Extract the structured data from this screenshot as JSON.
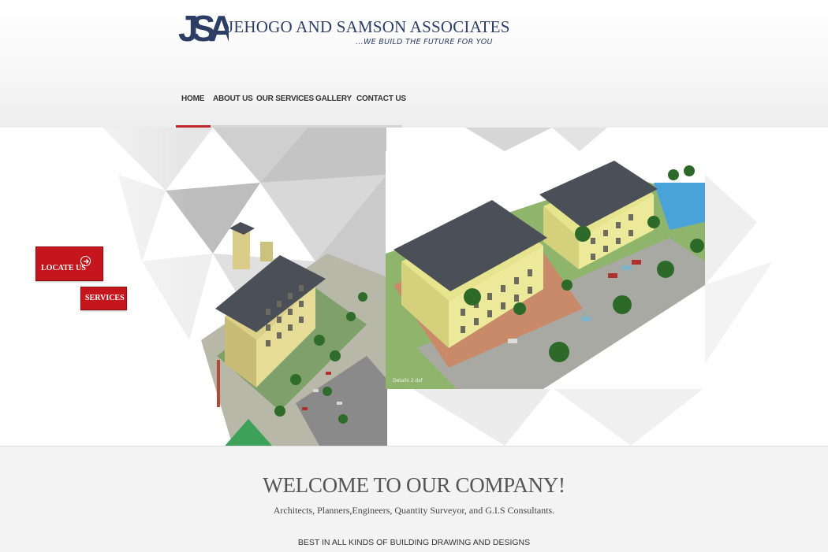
{
  "brand": {
    "logo_letters": "JSA",
    "name": "JEHOGO AND SAMSON ASSOCIATES",
    "tagline": "...WE BUILD THE FUTURE FOR YOU"
  },
  "nav": {
    "items": [
      {
        "label": "HOME",
        "active": true
      },
      {
        "label": "ABOUT US"
      },
      {
        "label": "OUR SERVICES"
      },
      {
        "label": "GALLERY"
      },
      {
        "label": "CONTACT US"
      }
    ]
  },
  "hero": {
    "caption": "Details 2.dxf",
    "buttons": {
      "locate_us": "LOCATE US",
      "services": "SERVICES"
    }
  },
  "welcome": {
    "title": "WELCOME TO OUR COMPANY!",
    "subtitle": "Architects, Planners,Engineers, Quantity Surveyor, and G.I.S Consultants.",
    "tagline": "BEST IN ALL KINDS OF BUILDING DRAWING AND DESIGNS"
  },
  "colors": {
    "brand_navy": "#2c3e66",
    "accent_red": "#c4161c",
    "nav_active_underline": "#c0272d"
  },
  "icons": [
    "arrow-circle-right-icon"
  ]
}
